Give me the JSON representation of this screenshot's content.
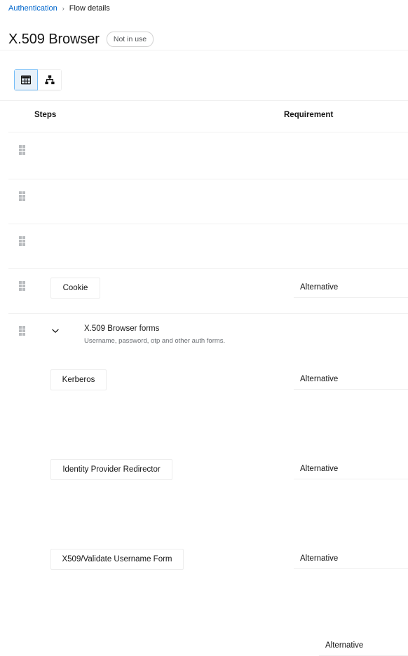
{
  "breadcrumb": {
    "parent_label": "Authentication",
    "separator": "›",
    "current_label": "Flow details"
  },
  "header": {
    "title": "X.509 Browser",
    "status_badge": "Not in use"
  },
  "view_toggle": {
    "options": [
      {
        "icon": "table-view-icon",
        "selected": true
      },
      {
        "icon": "tree-view-icon",
        "selected": false
      }
    ],
    "selected_accent": "#73bcf7",
    "selected_background": "#e7f1fa"
  },
  "table": {
    "columns": {
      "steps": "Steps",
      "requirement": "Requirement"
    },
    "rows": [
      {
        "grip": "drag-handle-icon",
        "step": "Cookie",
        "requirement": "Alternative"
      },
      {
        "grip": "drag-handle-icon",
        "step": "Kerberos",
        "requirement": "Alternative"
      },
      {
        "grip": "drag-handle-icon",
        "step": "Identity Provider Redirector",
        "requirement": "Alternative"
      },
      {
        "grip": "drag-handle-icon",
        "step": "X509/Validate Username Form",
        "requirement": "Alternative"
      },
      {
        "grip": "drag-handle-icon",
        "expand_icon": "chevron-down-icon",
        "step": "X.509 Browser forms",
        "step_description": "Username, password, otp and other auth forms.",
        "requirement": "Alternative"
      }
    ]
  }
}
